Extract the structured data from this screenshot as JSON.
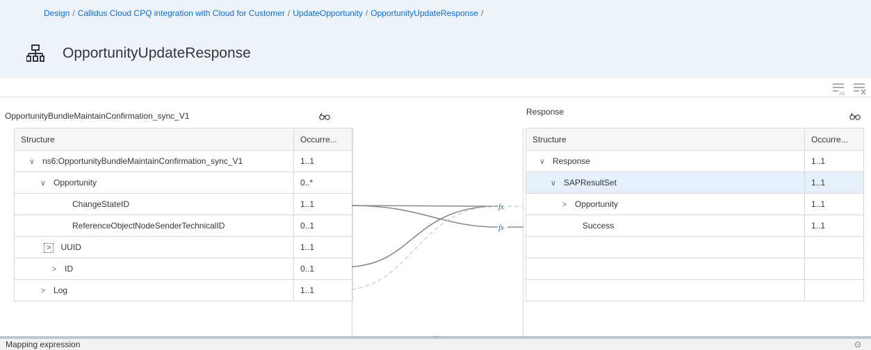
{
  "breadcrumb": {
    "items": [
      "Design",
      "Callidus Cloud CPQ integration with Cloud for Customer",
      "UpdateOpportunity",
      "OpportunityUpdateResponse"
    ],
    "separator": "/"
  },
  "page": {
    "title": "OpportunityUpdateResponse",
    "title_icon": "hierarchy-icon"
  },
  "toolbar": {
    "icons": [
      "text-format-icon",
      "clear-list-icon"
    ]
  },
  "source": {
    "title": "OpportunityBundleMaintainConfirmation_sync_V1",
    "columns": [
      "Structure",
      "Occurre..."
    ],
    "rows": [
      {
        "name": "ns6:OpportunityBundleMaintainConfirmation_sync_V1",
        "occ": "1..1"
      },
      {
        "name": "Opportunity",
        "occ": "0..*"
      },
      {
        "name": "ChangeStateID",
        "occ": "1..1"
      },
      {
        "name": "ReferenceObjectNodeSenderTechnicalID",
        "occ": "0..1"
      },
      {
        "name": "UUID",
        "occ": "1..1"
      },
      {
        "name": "ID",
        "occ": "0..1"
      },
      {
        "name": "Log",
        "occ": "1..1"
      }
    ]
  },
  "target": {
    "title": "Response",
    "columns": [
      "Structure",
      "Occurre..."
    ],
    "rows": [
      {
        "name": "Response",
        "occ": "1..1"
      },
      {
        "name": "SAPResultSet",
        "occ": "1..1"
      },
      {
        "name": "Opportunity",
        "occ": "1..1"
      },
      {
        "name": "Success",
        "occ": "1..1"
      }
    ]
  },
  "mapping": {
    "function_label_1": "fx",
    "function_label_2": "fx"
  },
  "footer": {
    "label": "Mapping expression"
  },
  "colors": {
    "accent": "#0a6ed1",
    "header_bg": "#eef3f8",
    "selected_row": "#e5f0fa"
  }
}
